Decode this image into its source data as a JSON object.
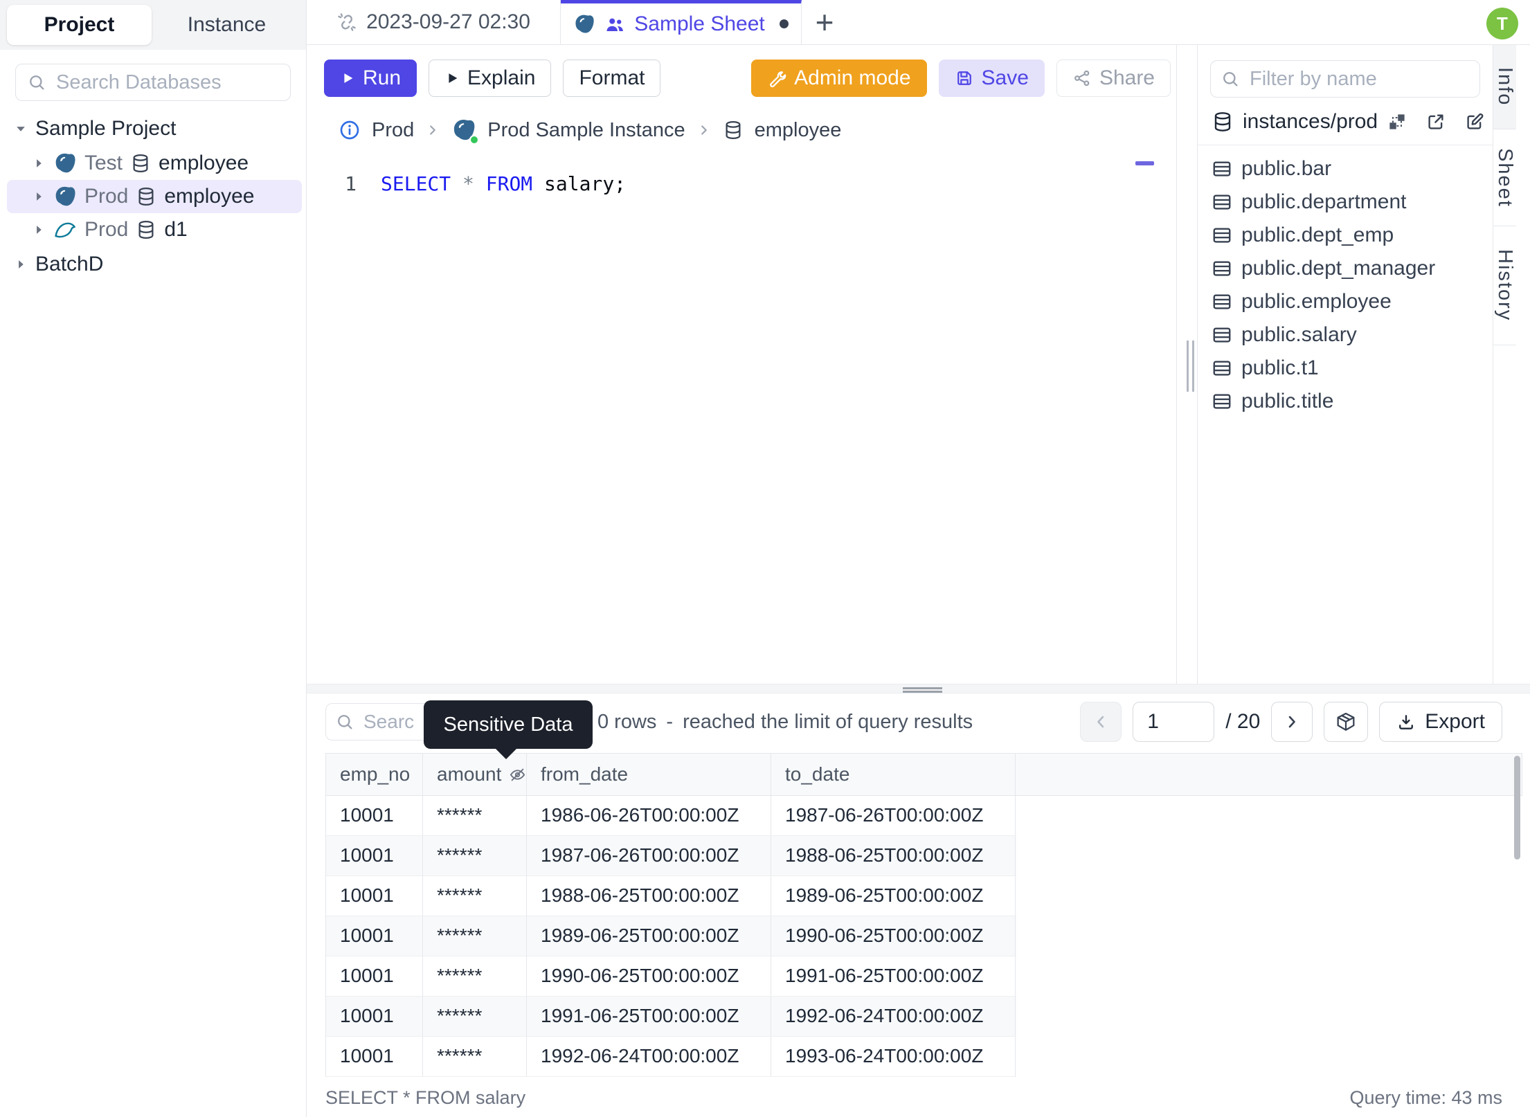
{
  "colors": {
    "accent_indigo": "#4f46e5",
    "admin_orange": "#f0a11e",
    "avatar_green": "#7cc243",
    "selected_tree_row": "#eceafc",
    "tooltip_bg": "#1d212b",
    "sql_keyword_blue": "#1a1af0",
    "postgres_blue": "#336791",
    "mysql_teal": "#0c7a99",
    "instance_status_green": "#34c759"
  },
  "icons": {
    "sidebar_search": "magnifier-icon",
    "temp_tab": "unlink-icon",
    "sheet_tab": [
      "postgres-icon",
      "people-icon"
    ],
    "run": "play-icon",
    "explain": "play-icon",
    "admin": "wrench-icon",
    "save": "floppy-disk-icon",
    "share": "share-nodes-icon",
    "breadcrumb": [
      "info-circle-icon",
      "postgres-icon",
      "database-icon"
    ],
    "schema_actions": [
      "schema-diagram-icon",
      "external-link-icon",
      "edit-icon"
    ],
    "table_item": "table-grid-icon",
    "masked_column": "eye-off-icon",
    "pagination": [
      "chevron-left-icon",
      "chevron-right-icon",
      "cube-icon"
    ],
    "export": "download-icon"
  },
  "sidebar": {
    "tabs": [
      "Project",
      "Instance"
    ],
    "search_placeholder": "Search Databases",
    "tree": {
      "project_label": "Sample Project",
      "databases": [
        {
          "environment": "Test",
          "name": "employee",
          "engine": "postgresql",
          "selected": false
        },
        {
          "environment": "Prod",
          "name": "employee",
          "engine": "postgresql",
          "selected": true
        },
        {
          "environment": "Prod",
          "name": "d1",
          "engine": "mysql",
          "selected": false
        }
      ],
      "group_label": "BatchD"
    }
  },
  "tabbar": {
    "tabs": [
      {
        "label": "2023-09-27 02:30",
        "active": false
      },
      {
        "label": "Sample Sheet",
        "active": true,
        "unsaved": true
      }
    ],
    "new_tab_label": "+"
  },
  "toolbar": {
    "run_label": "Run",
    "explain_label": "Explain",
    "format_label": "Format",
    "admin_label": "Admin mode",
    "save_label": "Save",
    "share_label": "Share"
  },
  "breadcrumb": {
    "environment": "Prod",
    "instance": "Prod Sample Instance",
    "database": "employee"
  },
  "editor": {
    "line_number": "1",
    "keyword_select": "SELECT",
    "star": "*",
    "keyword_from": "FROM",
    "identifier": "salary;"
  },
  "schema_panel": {
    "filter_placeholder": "Filter by name",
    "instance_path": "instances/prod",
    "tables": [
      "public.bar",
      "public.department",
      "public.dept_emp",
      "public.dept_manager",
      "public.employee",
      "public.salary",
      "public.t1",
      "public.title"
    ]
  },
  "right_tabs": [
    "Info",
    "Sheet",
    "History"
  ],
  "user_avatar": "T",
  "results": {
    "search_placeholder": "Searc",
    "tooltip": "Sensitive Data",
    "row_count": "0 rows",
    "dash": "-",
    "limit_message": "reached the limit of query results",
    "pagination": {
      "page": "1",
      "total_label": "/ 20"
    },
    "export_label": "Export",
    "table": {
      "headers": [
        "emp_no",
        "amount",
        "from_date",
        "to_date"
      ],
      "rows": [
        [
          "10001",
          "******",
          "1986-06-26T00:00:00Z",
          "1987-06-26T00:00:00Z"
        ],
        [
          "10001",
          "******",
          "1987-06-26T00:00:00Z",
          "1988-06-25T00:00:00Z"
        ],
        [
          "10001",
          "******",
          "1988-06-25T00:00:00Z",
          "1989-06-25T00:00:00Z"
        ],
        [
          "10001",
          "******",
          "1989-06-25T00:00:00Z",
          "1990-06-25T00:00:00Z"
        ],
        [
          "10001",
          "******",
          "1990-06-25T00:00:00Z",
          "1991-06-25T00:00:00Z"
        ],
        [
          "10001",
          "******",
          "1991-06-25T00:00:00Z",
          "1992-06-24T00:00:00Z"
        ],
        [
          "10001",
          "******",
          "1992-06-24T00:00:00Z",
          "1993-06-24T00:00:00Z"
        ]
      ]
    },
    "status": {
      "query": "SELECT * FROM salary",
      "time": "Query time: 43 ms"
    }
  }
}
